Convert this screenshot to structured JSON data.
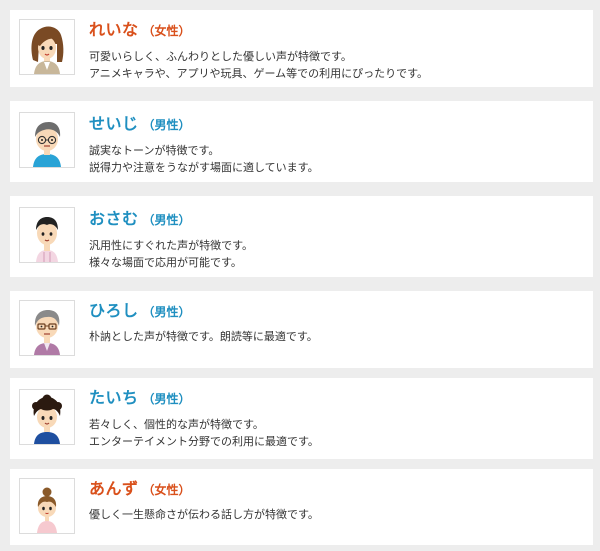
{
  "voices": [
    {
      "name": "れいな",
      "gender": "（女性）",
      "gender_type": "female",
      "icon": "woman-long-hair-avatar-icon",
      "description": [
        "可愛いらしく、ふんわりとした優しい声が特徴です。",
        "アニメキャラや、アプリや玩具、ゲーム等での利用にぴったりです。"
      ]
    },
    {
      "name": "せいじ",
      "gender": "（男性）",
      "gender_type": "male",
      "icon": "man-glasses-avatar-icon",
      "description": [
        "誠実なトーンが特徴です。",
        "説得力や注意をうながす場面に適しています。"
      ]
    },
    {
      "name": "おさむ",
      "gender": "（男性）",
      "gender_type": "male",
      "icon": "young-man-avatar-icon",
      "description": [
        "汎用性にすぐれた声が特徴です。",
        "様々な場面で応用が可能です。"
      ]
    },
    {
      "name": "ひろし",
      "gender": "（男性）",
      "gender_type": "male",
      "icon": "older-man-glasses-avatar-icon",
      "description": [
        "朴訥とした声が特徴です。朗読等に最適です。"
      ]
    },
    {
      "name": "たいち",
      "gender": "（男性）",
      "gender_type": "male",
      "icon": "boy-curly-hair-avatar-icon",
      "description": [
        "若々しく、個性的な声が特徴です。",
        "エンターテイメント分野での利用に最適です。"
      ]
    },
    {
      "name": "あんず",
      "gender": "（女性）",
      "gender_type": "female",
      "icon": "girl-topknot-avatar-icon",
      "description": [
        "優しく一生懸命さが伝わる話し方が特徴です。"
      ]
    }
  ]
}
